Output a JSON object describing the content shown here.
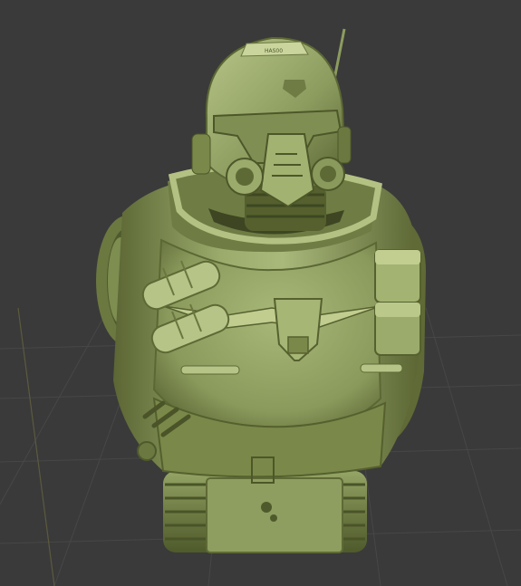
{
  "viewport": {
    "background": "#3a3a3a",
    "grid_color": "#4a4a4a",
    "axis_color": "#5c5a3e"
  },
  "model": {
    "material_color": "#8fa064",
    "shadow_color": "#4f5a2c",
    "highlight_color": "#c4d095",
    "helmet_text": "HAS00",
    "icons": [
      "emblem-icon",
      "grenade-icon",
      "pouch-icon"
    ]
  }
}
